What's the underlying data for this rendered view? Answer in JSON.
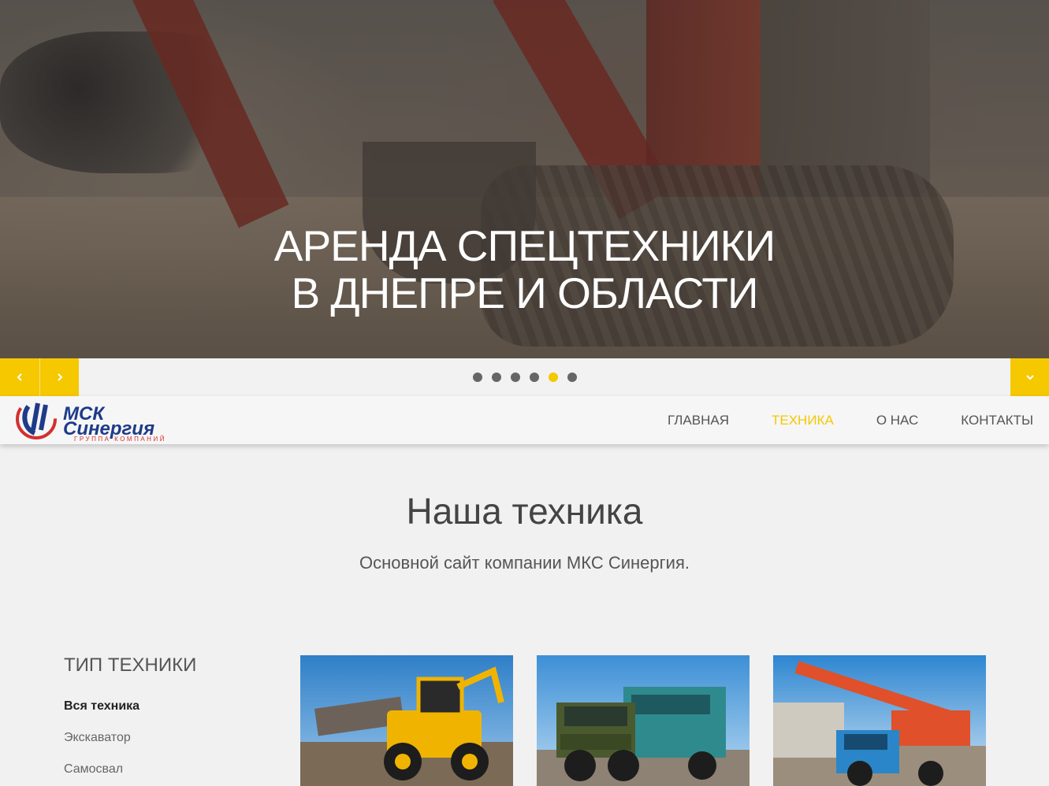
{
  "hero": {
    "title_line1": "АРЕНДА СПЕЦТЕХНИКИ",
    "title_line2": "В ДНЕПРЕ И ОБЛАСТИ"
  },
  "slider": {
    "dot_count": 6,
    "active_dot": 5,
    "accent_color": "#f5c800"
  },
  "logo": {
    "name_line1": "МСК",
    "name_line2": "Синергия",
    "tagline": "ГРУППА КОМПАНИЙ"
  },
  "menu": {
    "items": [
      {
        "label": "ГЛАВНАЯ",
        "active": false
      },
      {
        "label": "ТЕХНИКА",
        "active": true
      },
      {
        "label": "О НАС",
        "active": false
      },
      {
        "label": "КОНТАКТЫ",
        "active": false
      }
    ]
  },
  "main": {
    "title": "Наша техника",
    "subtitle": "Основной сайт компании МКС Синергия."
  },
  "sidebar": {
    "title": "ТИП ТЕХНИКИ",
    "categories": [
      {
        "label": "Вся техника",
        "active": true
      },
      {
        "label": "Экскаватор",
        "active": false
      },
      {
        "label": "Самосвал",
        "active": false
      }
    ]
  },
  "cards": [
    {
      "icon": "backhoe-loader-image"
    },
    {
      "icon": "gaz-truck-image"
    },
    {
      "icon": "crane-truck-image"
    }
  ]
}
